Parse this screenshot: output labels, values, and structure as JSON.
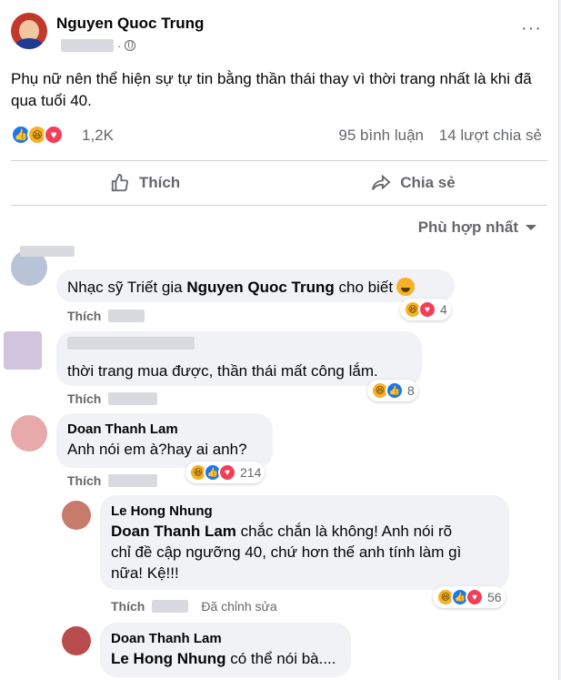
{
  "post": {
    "author": "Nguyen Quoc Trung",
    "separator": "·",
    "text": "Phụ nữ nên thể hiện sự tự tin bằng thần thái thay vì thời trang nhất là khi đã qua tuổi 40.",
    "reactions_count": "1,2K",
    "comments_count": "95 bình luận",
    "shares_count": "14 lượt chia sẻ",
    "more_icon": "···"
  },
  "actions": {
    "like_label": "Thích",
    "share_label": "Chia sẻ"
  },
  "sort": {
    "label": "Phù hợp nhất"
  },
  "comments": [
    {
      "prefix": "Nhạc sỹ Triết gia ",
      "mention": "Nguyen Quoc Trung",
      "suffix": " cho biết",
      "like": "Thích",
      "reaction_count": "4"
    },
    {
      "text": "thời trang mua được, thần thái mất công lắm.",
      "like": "Thích",
      "reaction_count": "8"
    },
    {
      "name": "Doan Thanh Lam",
      "text": "Anh nói em à?hay ai anh?",
      "like": "Thích",
      "reaction_count": "214"
    },
    {
      "name": "Le Hong Nhung",
      "mention": "Doan Thanh Lam",
      "text_line1": " chắc chắn là không! Anh nói rõ",
      "text_line2": "chỉ đề cập ngưỡng 40, chứ hơn thế anh tính làm gì",
      "text_line3": "nữa! Kệ!!!",
      "like": "Thích",
      "edited": "Đã chỉnh sửa",
      "reaction_count": "56"
    },
    {
      "name": "Doan Thanh Lam",
      "mention": "Le Hong Nhung",
      "text": " có thể nói bà...."
    }
  ],
  "colors": {
    "like_blue": "#1877f2",
    "haha_yellow": "#f7b125",
    "love_red": "#f33e58",
    "secondary_text": "#65676b"
  }
}
